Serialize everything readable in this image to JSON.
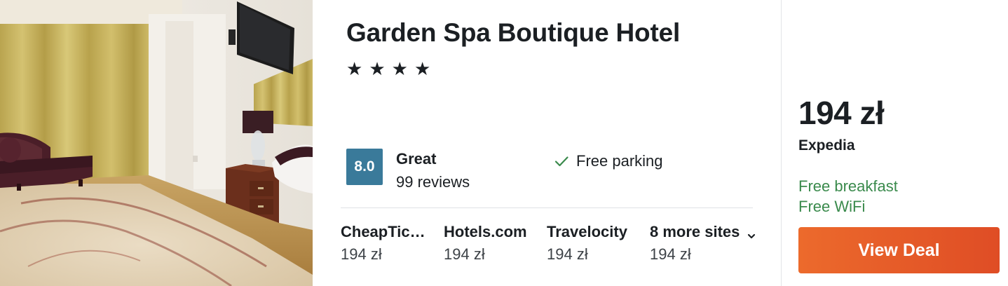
{
  "hotel": {
    "name": "Garden Spa Boutique Hotel",
    "stars": [
      "★",
      "★",
      "★",
      "★"
    ],
    "rating": {
      "score": "8.0",
      "label": "Great",
      "reviews": "99 reviews",
      "badge_color": "#3a7a9a"
    },
    "amenity": {
      "icon": "check-icon",
      "label": "Free parking",
      "color": "#3a8a4c"
    }
  },
  "sites": [
    {
      "name": "CheapTic…",
      "price": "194 zł"
    },
    {
      "name": "Hotels.com",
      "price": "194 zł"
    },
    {
      "name": "Travelocity",
      "price": "194 zł"
    },
    {
      "name": "8 more sites",
      "price": "194 zł",
      "icon": "chevron-down-icon"
    }
  ],
  "deal": {
    "price": "194 zł",
    "provider": "Expedia",
    "perks": [
      "Free breakfast",
      "Free WiFi"
    ],
    "perk_color": "#3a8a4c",
    "button_label": "View Deal",
    "button_colors": [
      "#ec6a2c",
      "#df4d25"
    ]
  }
}
